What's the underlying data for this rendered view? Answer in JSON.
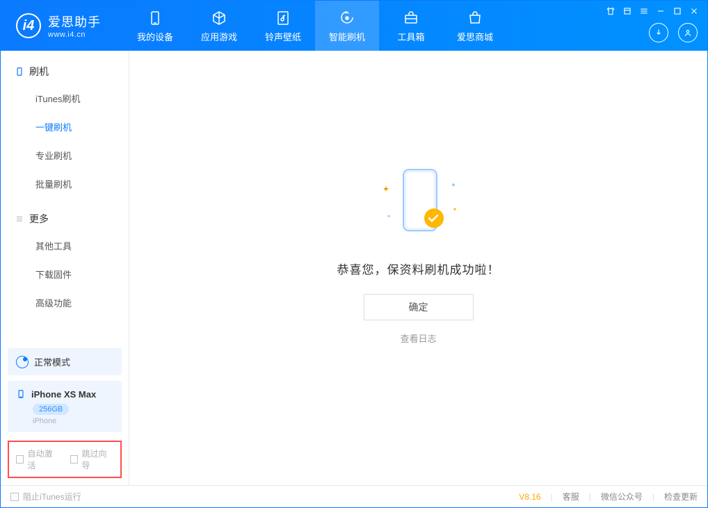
{
  "brand": {
    "title": "爱思助手",
    "subtitle": "www.i4.cn"
  },
  "nav": {
    "tabs": [
      {
        "label": "我的设备"
      },
      {
        "label": "应用游戏"
      },
      {
        "label": "铃声壁纸"
      },
      {
        "label": "智能刷机"
      },
      {
        "label": "工具箱"
      },
      {
        "label": "爱思商城"
      }
    ]
  },
  "sidebar": {
    "section1_title": "刷机",
    "section1_items": [
      "iTunes刷机",
      "一键刷机",
      "专业刷机",
      "批量刷机"
    ],
    "section2_title": "更多",
    "section2_items": [
      "其他工具",
      "下载固件",
      "高级功能"
    ],
    "status_label": "正常模式",
    "device": {
      "name": "iPhone XS Max",
      "capacity": "256GB",
      "type": "iPhone"
    },
    "cb1": "自动激活",
    "cb2": "跳过向导"
  },
  "main": {
    "success_text": "恭喜您，保资料刷机成功啦！",
    "ok_label": "确定",
    "log_link": "查看日志"
  },
  "footer": {
    "block_itunes": "阻止iTunes运行",
    "version": "V8.16",
    "links": [
      "客服",
      "微信公众号",
      "检查更新"
    ]
  }
}
